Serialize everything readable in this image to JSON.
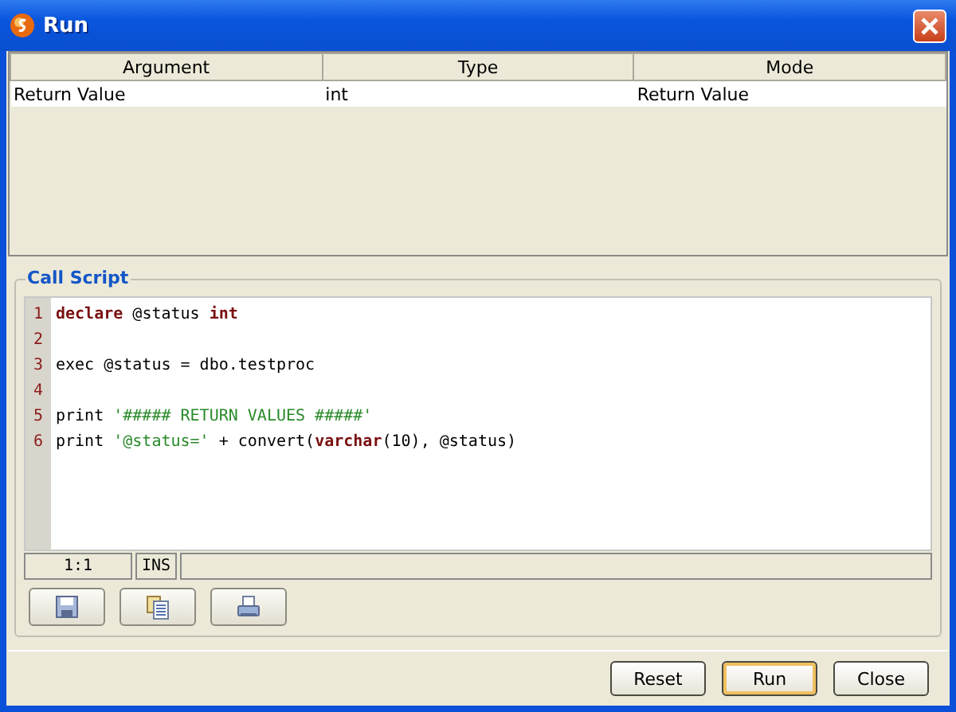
{
  "window": {
    "title": "Run"
  },
  "table": {
    "columns": [
      "Argument",
      "Type",
      "Mode"
    ],
    "rows": [
      [
        "Return Value",
        "int",
        "Return Value"
      ]
    ]
  },
  "call_script": {
    "title": "Call Script",
    "lines": [
      {
        "number": "1",
        "tokens": [
          {
            "kind": "keyword",
            "text": "declare"
          },
          {
            "kind": "plain",
            "text": " @status "
          },
          {
            "kind": "keyword",
            "text": "int"
          }
        ]
      },
      {
        "number": "2"
      },
      {
        "number": "3",
        "tokens": [
          {
            "kind": "plain",
            "text": "exec @status = dbo.testproc"
          }
        ]
      },
      {
        "number": "4"
      },
      {
        "number": "5",
        "tokens": [
          {
            "kind": "plain",
            "text": "print "
          },
          {
            "kind": "string",
            "text": "'##### RETURN VALUES #####'"
          }
        ]
      },
      {
        "number": "6",
        "tokens": [
          {
            "kind": "plain",
            "text": "print "
          },
          {
            "kind": "string",
            "text": "'@status='"
          },
          {
            "kind": "plain",
            "text": " + convert("
          },
          {
            "kind": "keyword",
            "text": "varchar"
          },
          {
            "kind": "plain",
            "text": "(10), @status)"
          }
        ]
      }
    ],
    "status": {
      "position": "1:1",
      "mode": "INS"
    },
    "tools": [
      {
        "kind": "save"
      },
      {
        "kind": "copy"
      },
      {
        "kind": "print"
      }
    ]
  },
  "buttons": [
    {
      "label": "Reset",
      "default": false
    },
    {
      "label": "Run",
      "default": true
    },
    {
      "label": "Close",
      "default": false
    }
  ]
}
